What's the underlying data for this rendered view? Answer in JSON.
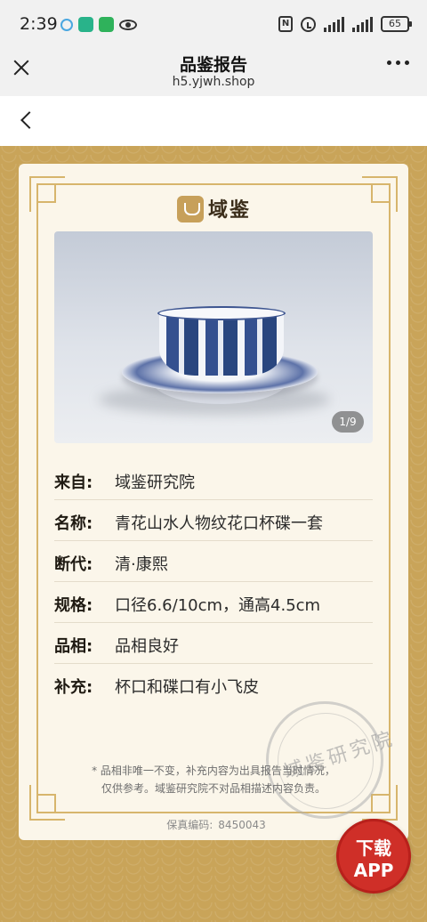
{
  "status_bar": {
    "time": "2:39",
    "battery": "65"
  },
  "title_bar": {
    "title": "品鉴报告",
    "url": "h5.yjwh.shop"
  },
  "logo": {
    "name": "域鉴"
  },
  "photo": {
    "counter": "1/9"
  },
  "fields": [
    {
      "key": "来自:",
      "value": "域鉴研究院"
    },
    {
      "key": "名称:",
      "value": "青花山水人物纹花口杯碟一套"
    },
    {
      "key": "断代:",
      "value": "清·康熙"
    },
    {
      "key": "规格:",
      "value": "口径6.6/10cm，通高4.5cm"
    },
    {
      "key": "品相:",
      "value": "品相良好"
    },
    {
      "key": "补充:",
      "value": "杯口和碟口有小飞皮"
    }
  ],
  "disclaimer": {
    "line1": "* 品相非唯一不变，补充内容为出具报告当时情况，",
    "line2": "仅供参考。域鉴研究院不对品相描述内容负责。"
  },
  "seal": {
    "text": "域鉴研究院"
  },
  "serial": {
    "label": "保真编码:",
    "value": "8450043"
  },
  "app_button": {
    "line1": "下载",
    "line2": "APP"
  },
  "colors": {
    "gold": "#c9a459",
    "card": "#fbf6ea",
    "app_red": "#cf2f28"
  }
}
